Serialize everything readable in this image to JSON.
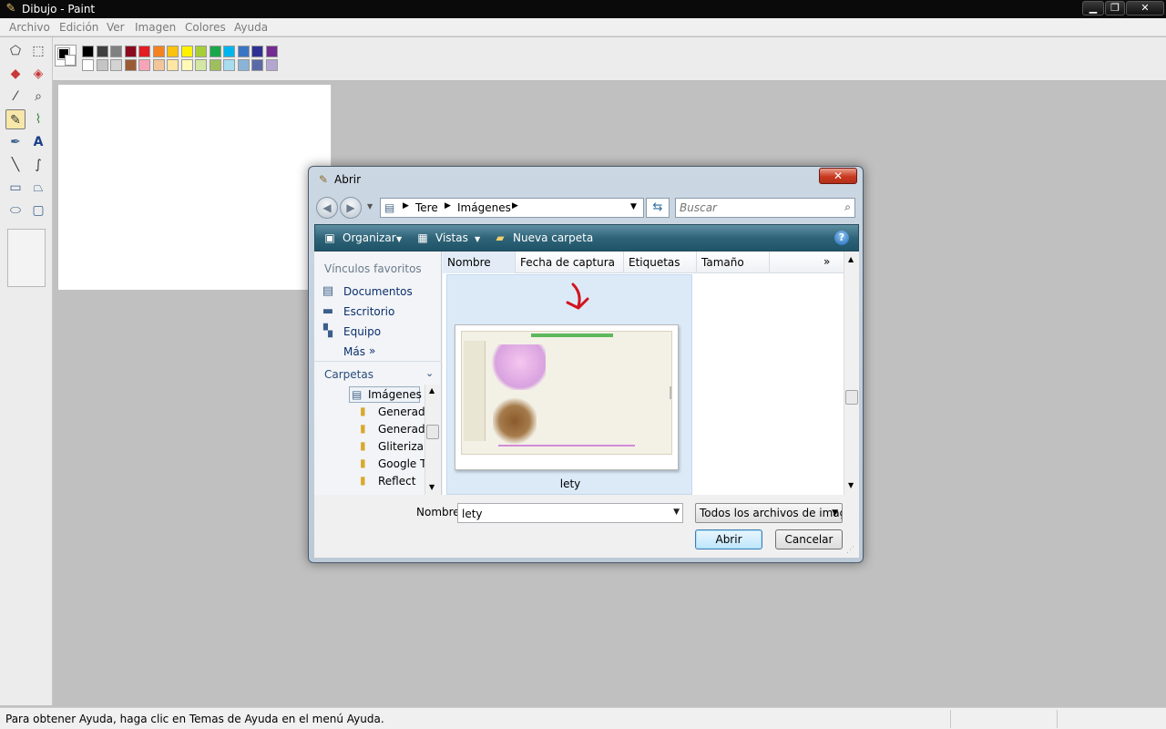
{
  "window": {
    "title": "Dibujo - Paint"
  },
  "menu": [
    "Archivo",
    "Edición",
    "Ver",
    "Imagen",
    "Colores",
    "Ayuda"
  ],
  "status": {
    "text": "Para obtener Ayuda, haga clic en Temas de Ayuda en el menú Ayuda."
  },
  "palette": {
    "foreground": "#000000",
    "background": "#ffffff",
    "top_row": [
      "#000000",
      "#404040",
      "#808080",
      "#8b0a1e",
      "#e31b23",
      "#f58220",
      "#fdc20d",
      "#fff200",
      "#a6ce39",
      "#1aa74a",
      "#00b4ee",
      "#3a75c4",
      "#2e3192",
      "#732c91"
    ],
    "bottom_row": [
      "#ffffff",
      "#c4c4c4",
      "#d3d3d3",
      "#9a5b34",
      "#f8a4b8",
      "#f2c59a",
      "#fee6a5",
      "#fff8b8",
      "#d3e7a3",
      "#9ebf5c",
      "#a8dcef",
      "#8ab4d7",
      "#5a6aa6",
      "#b4a6d1"
    ]
  },
  "dialog": {
    "title": "Abrir",
    "breadcrumb": [
      "Tere",
      "Imágenes"
    ],
    "search_placeholder": "Buscar",
    "commands": {
      "organize": "Organizar",
      "views": "Vistas",
      "new_folder": "Nueva carpeta"
    },
    "nav": {
      "favorites_title": "Vínculos favoritos",
      "favorites": [
        "Documentos",
        "Escritorio",
        "Equipo"
      ],
      "more": "Más",
      "folders_title": "Carpetas",
      "tree": [
        "Imágenes",
        "Generado",
        "Generado",
        "Gliterizar",
        "Google T",
        "Reflect"
      ]
    },
    "columns": [
      "Nombre",
      "Fecha de captura",
      "Etiquetas",
      "Tamaño"
    ],
    "file": {
      "name": "lety"
    },
    "name_label": "Nombre:",
    "name_value": "lety",
    "filetype": "Todos los archivos de imager",
    "open_label": "Abrir",
    "cancel_label": "Cancelar"
  }
}
